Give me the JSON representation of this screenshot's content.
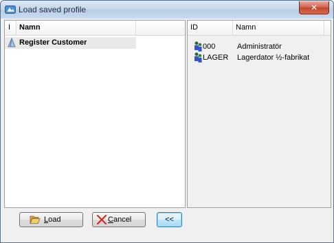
{
  "window": {
    "title": "Load saved profile",
    "close_symbol": "✕"
  },
  "profiles_grid": {
    "headers": [
      "I",
      "Namn"
    ],
    "rows": [
      {
        "icon": "profile-icon",
        "name": "Register Customer"
      }
    ]
  },
  "users_grid": {
    "headers": [
      "ID",
      "Namn"
    ],
    "rows": [
      {
        "icon": "user-icon",
        "id": "000",
        "name": "Administratör"
      },
      {
        "icon": "user-icon",
        "id": "LAGER",
        "name": "Lagerdator ½-fabrikat"
      }
    ]
  },
  "buttons": {
    "load": {
      "label_first": "L",
      "label_rest": "oad",
      "icon": "folder-open-icon"
    },
    "cancel": {
      "label_first": "C",
      "label_rest": "ancel",
      "icon": "red-x-icon"
    },
    "transfer": {
      "label": "<<"
    }
  },
  "colors": {
    "titlebar": "#c4d6ea",
    "close_button": "#c3442e",
    "selected_row": "#e9e9e9",
    "focused_button_border": "#3c7fb1"
  }
}
